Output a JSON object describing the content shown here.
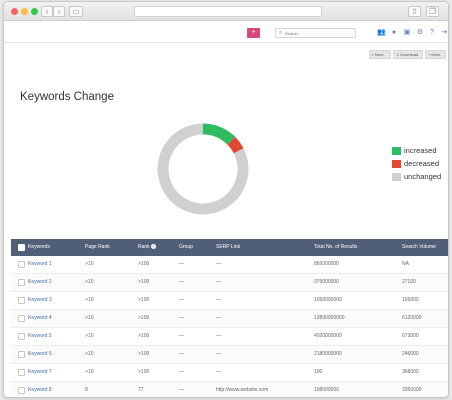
{
  "colors": {
    "accent": "#d9487a",
    "header_bg": "#515e78",
    "link": "#3e6bb3"
  },
  "search": {
    "placeholder": "Search"
  },
  "toolbar": {
    "save_label": "Save",
    "download_label": "Download",
    "more_label": "More"
  },
  "page": {
    "title": "Keywords Change"
  },
  "chart_data": {
    "type": "pie",
    "title": "",
    "categories": [
      "increased",
      "decreased",
      "unchanged"
    ],
    "values": [
      12.5,
      5,
      82.5
    ],
    "colors": [
      "#2fbb5f",
      "#e34836",
      "#d0d0d0"
    ],
    "legend_position": "right"
  },
  "legend": {
    "items": [
      {
        "label": "increased",
        "color": "#2fbb5f"
      },
      {
        "label": "decreased",
        "color": "#e34836"
      },
      {
        "label": "unchanged",
        "color": "#d0d0d0"
      }
    ]
  },
  "table": {
    "headers": {
      "keywords": "Keywords",
      "page_rank": "Page Rank",
      "rank": "Rank",
      "group": "Group",
      "serp": "SERP Link",
      "total": "Total No. of Results",
      "volume": "Search Volume"
    },
    "rows": [
      {
        "keyword": "Keyword 1",
        "page_rank": ">10",
        "rank": ">100",
        "group": "—",
        "serp": "—",
        "total": "865000000",
        "volume": "NA"
      },
      {
        "keyword": "Keyword 2",
        "page_rank": ">10",
        "rank": ">100",
        "group": "—",
        "serp": "—",
        "total": "375000000",
        "volume": "27100"
      },
      {
        "keyword": "Keyword 3",
        "page_rank": ">10",
        "rank": ">100",
        "group": "—",
        "serp": "—",
        "total": "1050000000",
        "volume": "165000"
      },
      {
        "keyword": "Keyword 4",
        "page_rank": ">10",
        "rank": ">100",
        "group": "—",
        "serp": "—",
        "total": "13890000000",
        "volume": "6120000"
      },
      {
        "keyword": "Keyword 5",
        "page_rank": ">10",
        "rank": ">100",
        "group": "—",
        "serp": "—",
        "total": "4020000000",
        "volume": "673000"
      },
      {
        "keyword": "Keyword 6",
        "page_rank": ">10",
        "rank": ">100",
        "group": "—",
        "serp": "—",
        "total": "2180000000",
        "volume": "246000"
      },
      {
        "keyword": "Keyword 7",
        "page_rank": ">10",
        "rank": ">100",
        "group": "—",
        "serp": "—",
        "total": "100",
        "volume": "368000"
      },
      {
        "keyword": "Keyword 8",
        "page_rank": "8",
        "rank": "77",
        "group": "—",
        "serp": "http://www.website.com",
        "total": "108000000",
        "volume": "3350000"
      }
    ]
  }
}
